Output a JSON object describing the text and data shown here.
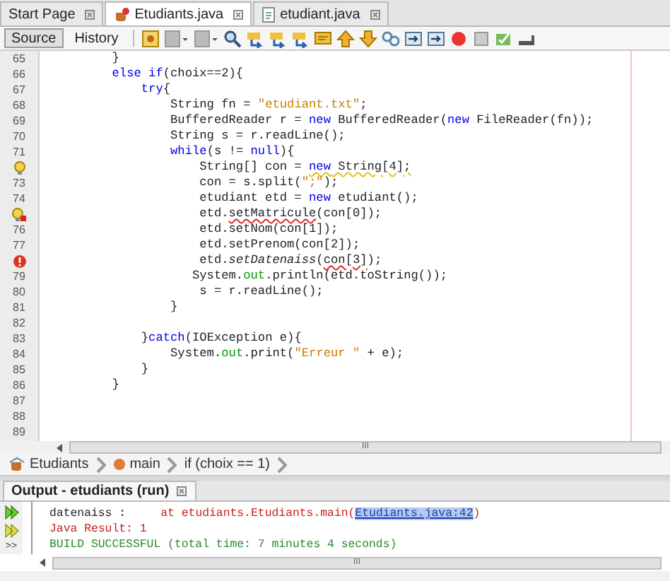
{
  "tabs": [
    {
      "label": "Start Page",
      "selected": false
    },
    {
      "label": "Etudiants.java",
      "selected": true
    },
    {
      "label": "etudiant.java",
      "selected": false
    }
  ],
  "view_buttons": [
    {
      "label": "Source",
      "selected": true
    },
    {
      "label": "History",
      "selected": false
    }
  ],
  "editor": {
    "lines": [
      {
        "kind": "code",
        "number": "65",
        "segments": [
          {
            "text": "        }",
            "kind": "plain"
          }
        ]
      },
      {
        "kind": "code",
        "number": "66",
        "segments": [
          {
            "text": "        else if",
            "kind": "keyword"
          },
          {
            "text": "(choix==2){",
            "kind": "plain"
          }
        ]
      },
      {
        "kind": "code",
        "number": "67",
        "segments": [
          {
            "text": "            try",
            "kind": "keyword"
          },
          {
            "text": "{",
            "kind": "plain"
          }
        ]
      },
      {
        "kind": "code",
        "number": "68",
        "segments": [
          {
            "text": "                String fn = ",
            "kind": "plain"
          },
          {
            "text": "\"etudiant.txt\"",
            "kind": "string"
          },
          {
            "text": ";",
            "kind": "plain"
          }
        ]
      },
      {
        "kind": "code",
        "number": "69",
        "segments": [
          {
            "text": "                BufferedReader r = ",
            "kind": "plain"
          },
          {
            "text": "new",
            "kind": "keyword"
          },
          {
            "text": " BufferedReader(",
            "kind": "plain"
          },
          {
            "text": "new",
            "kind": "keyword"
          },
          {
            "text": " FileReader(fn));",
            "kind": "plain"
          }
        ]
      },
      {
        "kind": "code",
        "number": "70",
        "segments": [
          {
            "text": "                String s = r.readLine();",
            "kind": "plain"
          }
        ]
      },
      {
        "kind": "code",
        "number": "71",
        "segments": [
          {
            "text": "                while",
            "kind": "keyword"
          },
          {
            "text": "(s != ",
            "kind": "plain"
          },
          {
            "text": "null",
            "kind": "keyword"
          },
          {
            "text": "){",
            "kind": "plain"
          }
        ]
      },
      {
        "kind": "warning",
        "segments": [
          {
            "text": "                    String[] con = ",
            "kind": "plain"
          },
          {
            "text": "new",
            "kind": "keyword",
            "underlined": true
          },
          {
            "text": " String[4];",
            "kind": "plain",
            "underlined": true
          }
        ]
      },
      {
        "kind": "code",
        "number": "73",
        "segments": [
          {
            "text": "                    con = s.split(",
            "kind": "plain"
          },
          {
            "text": "\";\"",
            "kind": "string"
          },
          {
            "text": ");",
            "kind": "plain"
          }
        ]
      },
      {
        "kind": "code",
        "number": "74",
        "segments": [
          {
            "text": "                    etudiant etd = ",
            "kind": "plain"
          },
          {
            "text": "new",
            "kind": "keyword"
          },
          {
            "text": " etudiant();",
            "kind": "plain"
          }
        ]
      },
      {
        "kind": "hint-error",
        "segments": [
          {
            "text": "                    etd.",
            "kind": "plain"
          },
          {
            "text": "setMatricule",
            "kind": "plain",
            "underlined": true
          },
          {
            "text": "(con[0]);",
            "kind": "plain"
          }
        ]
      },
      {
        "kind": "code",
        "number": "76",
        "segments": [
          {
            "text": "                    etd.setNom(con[1]);",
            "kind": "plain"
          }
        ]
      },
      {
        "kind": "code",
        "number": "77",
        "segments": [
          {
            "text": "                    etd.setPrenom(con[2]);",
            "kind": "plain"
          }
        ]
      },
      {
        "kind": "error",
        "segments": [
          {
            "text": "                    etd.",
            "kind": "plain"
          },
          {
            "text": "setDatenaiss",
            "kind": "italic"
          },
          {
            "text": "(",
            "kind": "plain"
          },
          {
            "text": "con[3]",
            "kind": "plain",
            "underlined": true
          },
          {
            "text": ");",
            "kind": "plain"
          }
        ]
      },
      {
        "kind": "code",
        "number": "79",
        "segments": [
          {
            "text": "                   System.",
            "kind": "plain"
          },
          {
            "text": "out",
            "kind": "field"
          },
          {
            "text": ".println(etd.toString());",
            "kind": "plain"
          }
        ]
      },
      {
        "kind": "code",
        "number": "80",
        "segments": [
          {
            "text": "                    s = r.readLine();",
            "kind": "plain"
          }
        ]
      },
      {
        "kind": "code",
        "number": "81",
        "segments": [
          {
            "text": "                }",
            "kind": "plain"
          }
        ]
      },
      {
        "kind": "code",
        "number": "82"
      },
      {
        "kind": "code",
        "number": "83",
        "segments": [
          {
            "text": "            }",
            "kind": "plain"
          },
          {
            "text": "catch",
            "kind": "keyword"
          },
          {
            "text": "(IOException e){",
            "kind": "plain"
          }
        ]
      },
      {
        "kind": "code",
        "number": "84",
        "segments": [
          {
            "text": "                System.",
            "kind": "plain"
          },
          {
            "text": "out",
            "kind": "field"
          },
          {
            "text": ".print(",
            "kind": "plain"
          },
          {
            "text": "\"Erreur \"",
            "kind": "string"
          },
          {
            "text": " + e);",
            "kind": "plain"
          }
        ]
      },
      {
        "kind": "code",
        "number": "85",
        "segments": [
          {
            "text": "            }",
            "kind": "plain"
          }
        ]
      },
      {
        "kind": "code",
        "number": "86",
        "segments": [
          {
            "text": "        }",
            "kind": "plain"
          }
        ]
      },
      {
        "kind": "code",
        "number": "87"
      },
      {
        "kind": "code",
        "number": "88"
      },
      {
        "kind": "code",
        "number": "89"
      }
    ]
  },
  "editor_scroll_grip": "III",
  "breadcrumbs": [
    {
      "label": "Etudiants"
    },
    {
      "label": "main"
    },
    {
      "label": "if (choix == 1)"
    }
  ],
  "output": {
    "title": "Output - etudiants (run)",
    "side_glyph": ">>",
    "lines": [
      {
        "segments": [
          {
            "text": "datenaiss :     ",
            "kind": "plain"
          },
          {
            "text": "at etudiants.Etudiants.main(",
            "kind": "error"
          },
          {
            "text": "Etudiants.java:42",
            "kind": "link"
          },
          {
            "text": ")",
            "kind": "error"
          }
        ]
      },
      {
        "segments": [
          {
            "text": "Java Result: 1",
            "kind": "error"
          }
        ]
      },
      {
        "segments": [
          {
            "text": "BUILD SUCCESSFUL (total time: 7 minutes 4 seconds)",
            "kind": "success"
          }
        ]
      }
    ],
    "scroll_grip": "III"
  }
}
